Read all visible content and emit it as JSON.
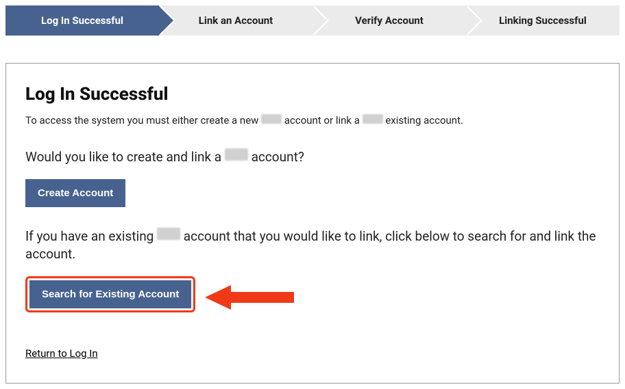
{
  "stepper": {
    "items": [
      {
        "label": "Log In Successful",
        "active": true
      },
      {
        "label": "Link an Account",
        "active": false
      },
      {
        "label": "Verify Account",
        "active": false
      },
      {
        "label": "Linking Successful",
        "active": false
      }
    ]
  },
  "panel": {
    "title": "Log In Successful",
    "intro_parts": {
      "p1": "To access the system you must either create a new ",
      "p2": " account or link a ",
      "p3": " existing account."
    },
    "redacted_placeholder": "████",
    "create_prompt_parts": {
      "p1": "Would you like to create and link a ",
      "p2": " account?"
    },
    "create_button": "Create Account",
    "existing_prompt_parts": {
      "p1": "If you have an existing ",
      "p2": " account that you would like to link, click below to search for and link the account."
    },
    "search_button": "Search for Existing Account",
    "return_link": "Return to Log In"
  },
  "annotation": {
    "arrow_color": "#f03a17"
  }
}
